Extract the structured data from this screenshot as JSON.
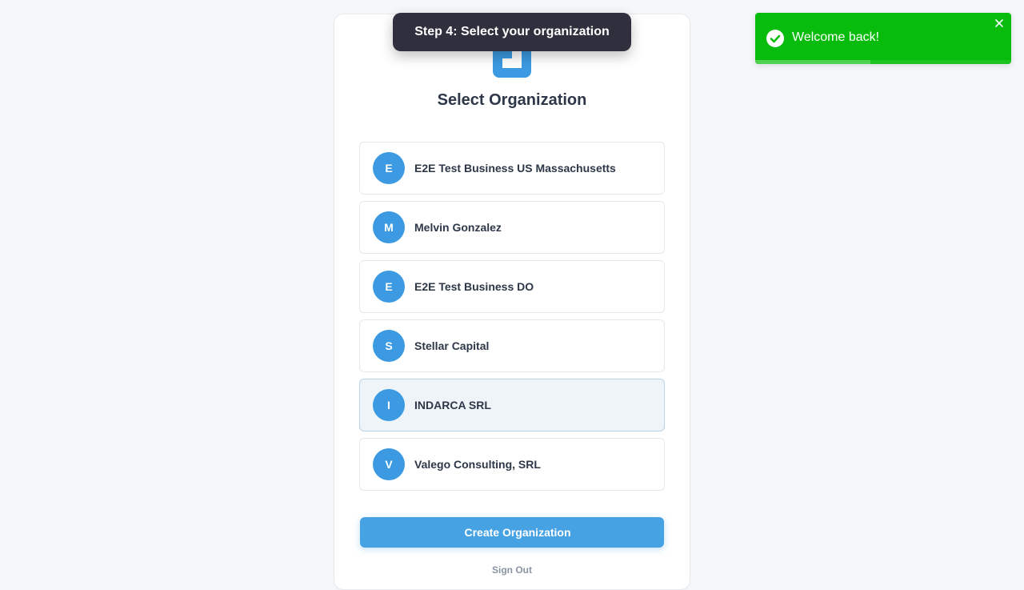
{
  "tooltip": {
    "text": "Step 4: Select your organization"
  },
  "page": {
    "title": "Select Organization"
  },
  "organizations": [
    {
      "initial": "E",
      "name": "E2E Test Business US Massachusetts",
      "selected": false
    },
    {
      "initial": "M",
      "name": "Melvin Gonzalez",
      "selected": false
    },
    {
      "initial": "E",
      "name": "E2E Test Business DO",
      "selected": false
    },
    {
      "initial": "S",
      "name": "Stellar Capital",
      "selected": false
    },
    {
      "initial": "I",
      "name": "INDARCA SRL",
      "selected": true
    },
    {
      "initial": "V",
      "name": "Valego Consulting, SRL",
      "selected": false
    }
  ],
  "actions": {
    "create_label": "Create Organization",
    "signout_label": "Sign Out"
  },
  "toast": {
    "message": "Welcome back!",
    "progress": 0.45,
    "icon": "check-circle-icon",
    "close_icon": "close-icon"
  },
  "colors": {
    "accent": "#3b9ae1",
    "button": "#47a2e3",
    "toast_success": "#07bc0c",
    "tooltip_bg": "#2f2f3d"
  }
}
